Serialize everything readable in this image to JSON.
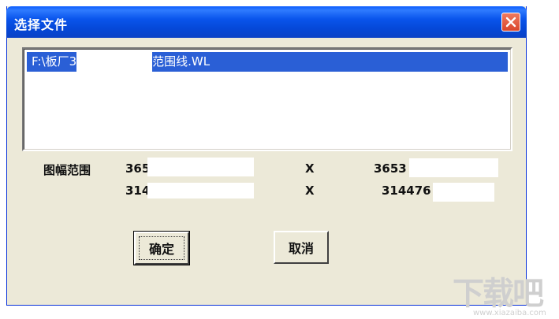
{
  "dialog": {
    "title": "选择文件"
  },
  "file_list": {
    "items": [
      {
        "label_start": "F:\\板厂3",
        "label_end": "范围线.WL",
        "selected": true
      }
    ]
  },
  "map_range": {
    "label": "图幅范围",
    "row1": {
      "from": "365",
      "separator": "X",
      "to": "3653"
    },
    "row2": {
      "from": "314",
      "separator": "X",
      "to": "314476"
    }
  },
  "buttons": {
    "ok": "确定",
    "cancel": "取消"
  },
  "watermark": {
    "text": "下载吧",
    "url": "www.xiazaiba.com"
  },
  "colors": {
    "titlebar": "#0a55ec",
    "dialog_bg": "#ece9d8",
    "selection": "#2a5fd6",
    "close_button": "#d9452b"
  }
}
